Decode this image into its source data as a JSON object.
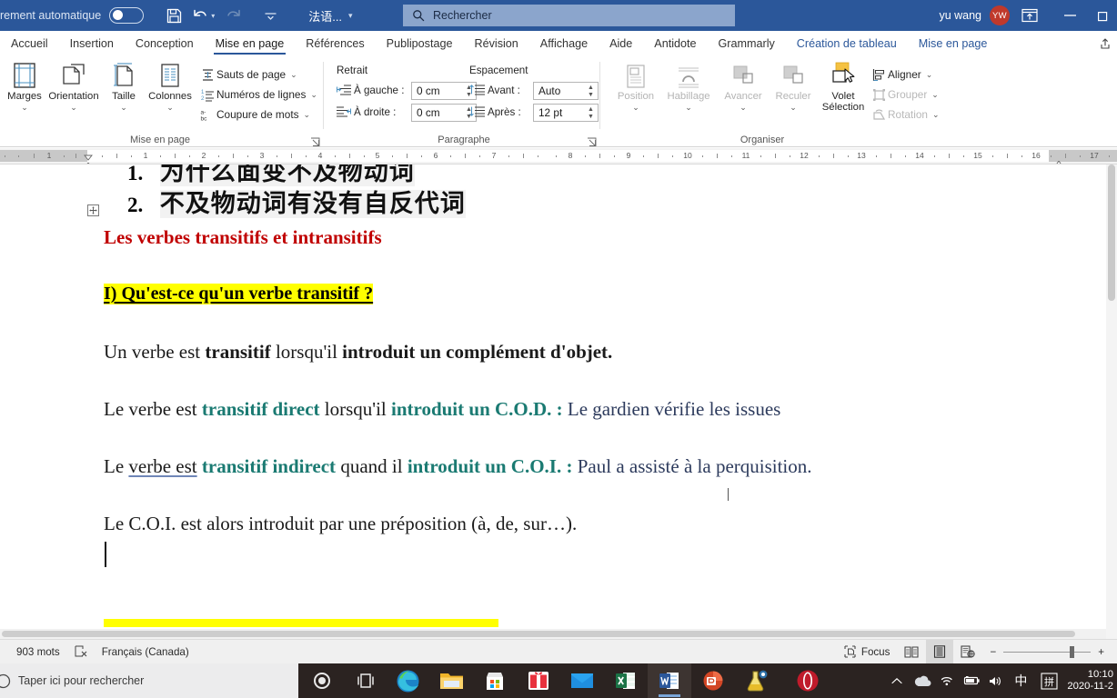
{
  "titlebar": {
    "autosave_label": "rement automatique",
    "autosave_on": false,
    "save_icon": "save-icon",
    "undo_icon": "undo-icon",
    "redo_icon": "redo-icon",
    "customize_icon": "customize-quick-access-icon",
    "language": "法语...",
    "search_placeholder": "Rechercher",
    "search_icon": "search-icon",
    "user_name": "yu wang",
    "user_initials": "YW",
    "ribbon_display_icon": "ribbon-display-options-icon",
    "minimize_icon": "minimize-icon",
    "restore_icon": "restore-icon",
    "accent_color": "#2b579a"
  },
  "tabs": [
    {
      "label": "Accueil",
      "active": false,
      "contextual": false
    },
    {
      "label": "Insertion",
      "active": false,
      "contextual": false
    },
    {
      "label": "Conception",
      "active": false,
      "contextual": false
    },
    {
      "label": "Mise en page",
      "active": true,
      "contextual": false
    },
    {
      "label": "Références",
      "active": false,
      "contextual": false
    },
    {
      "label": "Publipostage",
      "active": false,
      "contextual": false
    },
    {
      "label": "Révision",
      "active": false,
      "contextual": false
    },
    {
      "label": "Affichage",
      "active": false,
      "contextual": false
    },
    {
      "label": "Aide",
      "active": false,
      "contextual": false
    },
    {
      "label": "Antidote",
      "active": false,
      "contextual": false
    },
    {
      "label": "Grammarly",
      "active": false,
      "contextual": false
    },
    {
      "label": "Création de tableau",
      "active": false,
      "contextual": true
    },
    {
      "label": "Mise en page",
      "active": false,
      "contextual": true
    }
  ],
  "ribbon": {
    "groups": [
      {
        "title": "Mise en page"
      },
      {
        "title": "Paragraphe"
      },
      {
        "title": "Organiser"
      }
    ],
    "page_setup": {
      "buttons": [
        {
          "label": "Marges",
          "icon": "margins-icon",
          "has_chevron": true
        },
        {
          "label": "Orientation",
          "icon": "orientation-icon",
          "has_chevron": true
        },
        {
          "label": "Taille",
          "icon": "size-icon",
          "has_chevron": true
        },
        {
          "label": "Colonnes",
          "icon": "columns-icon",
          "has_chevron": true
        }
      ],
      "small_items": [
        {
          "label": "Sauts de page",
          "icon": "page-breaks-icon"
        },
        {
          "label": "Numéros de lignes",
          "icon": "line-numbers-icon"
        },
        {
          "label": "Coupure de mots",
          "icon": "hyphenation-icon"
        }
      ]
    },
    "paragraph": {
      "indent_header": "Retrait",
      "spacing_header": "Espacement",
      "fields": [
        {
          "label": "À gauche :",
          "value": "0 cm",
          "icon": "indent-left-icon"
        },
        {
          "label": "À droite :",
          "value": "0 cm",
          "icon": "indent-right-icon"
        },
        {
          "label": "Avant :",
          "value": "Auto",
          "icon": "spacing-before-icon"
        },
        {
          "label": "Après :",
          "value": "12 pt",
          "icon": "spacing-after-icon"
        }
      ]
    },
    "arrange": {
      "buttons": [
        {
          "label": "Position",
          "icon": "position-icon",
          "disabled": true,
          "has_chevron": true
        },
        {
          "label": "Habillage",
          "icon": "text-wrap-icon",
          "disabled": true,
          "has_chevron": true
        },
        {
          "label": "Avancer",
          "icon": "bring-forward-icon",
          "disabled": true,
          "has_chevron": true
        },
        {
          "label": "Reculer",
          "icon": "send-backward-icon",
          "disabled": true,
          "has_chevron": true
        },
        {
          "label": "Volet",
          "label2": "Sélection",
          "icon": "selection-pane-icon",
          "disabled": false
        }
      ],
      "small_items": [
        {
          "label": "Aligner",
          "icon": "align-icon",
          "disabled": false
        },
        {
          "label": "Grouper",
          "icon": "group-icon",
          "disabled": true
        },
        {
          "label": "Rotation",
          "icon": "rotate-icon",
          "disabled": true
        }
      ]
    }
  },
  "ruler": {
    "left_ticks": [
      "1"
    ],
    "ticks": [
      "1",
      "2",
      "3",
      "4",
      "5",
      "6",
      "7",
      "8",
      "9",
      "10",
      "11",
      "12",
      "13",
      "14",
      "15",
      "16",
      "17"
    ],
    "unit": "cm"
  },
  "document": {
    "lines": [
      {
        "type": "cjk-list",
        "number": "1.",
        "text": "为什么面变不及物动词",
        "clipped": true
      },
      {
        "type": "cjk-list",
        "number": "2.",
        "text": "不及物动词有没有自反代词",
        "clipped": false
      },
      {
        "type": "heading-red",
        "text": "Les verbes transitifs et intransitifs"
      },
      {
        "type": "heading-highlight",
        "text": "I) Qu'est-ce qu'un verbe transitif ?"
      },
      {
        "type": "rich",
        "runs": [
          {
            "t": "Un verbe est ",
            "style": "plain"
          },
          {
            "t": "transitif",
            "style": "bold"
          },
          {
            "t": " lorsqu'il ",
            "style": "plain"
          },
          {
            "t": "introduit un complément d'objet.",
            "style": "bold"
          }
        ]
      },
      {
        "type": "rich",
        "runs": [
          {
            "t": "Le verbe est ",
            "style": "plain"
          },
          {
            "t": "transitif direct",
            "style": "teal-bold"
          },
          {
            "t": " lorsqu'il ",
            "style": "plain"
          },
          {
            "t": "introduit un C.O.D. :",
            "style": "teal-bold"
          },
          {
            "t": "  Le gardien vérifie les issues",
            "style": "navy"
          }
        ]
      },
      {
        "type": "rich",
        "runs": [
          {
            "t": "Le ",
            "style": "plain"
          },
          {
            "t": "verbe  est",
            "style": "underline"
          },
          {
            "t": " ",
            "style": "plain"
          },
          {
            "t": "transitif indirect",
            "style": "teal-bold"
          },
          {
            "t": " quand il ",
            "style": "plain"
          },
          {
            "t": "introduit un C.O.I. :",
            "style": "teal-bold"
          },
          {
            "t": " Paul a assisté à la perquisition.",
            "style": "navy"
          }
        ]
      },
      {
        "type": "rich",
        "runs": [
          {
            "t": "Le C.O.I. est alors introduit par une préposition (à, de, sur…).",
            "style": "plain"
          }
        ]
      }
    ],
    "highlight_color": "#ffff00",
    "heading_color": "#c00000",
    "teal_color": "#1a7a72",
    "navy_color": "#2c3a5c",
    "move_handle_icon": "table-move-handle-icon"
  },
  "statusbar": {
    "word_count": "903 mots",
    "proofing_icon": "proofing-errors-icon",
    "language": "Français (Canada)",
    "focus_label": "Focus",
    "focus_icon": "focus-mode-icon",
    "view_read_icon": "read-mode-icon",
    "view_print_icon": "print-layout-icon",
    "view_web_icon": "web-layout-icon",
    "zoom_out": "−",
    "zoom_in": "+"
  },
  "taskbar": {
    "search_placeholder": "Taper ici pour rechercher",
    "search_icon": "cortana-circle-icon",
    "taskview_icon": "task-view-icon",
    "apps": [
      {
        "name": "edge-icon",
        "running": true,
        "active": false
      },
      {
        "name": "file-explorer-icon",
        "running": true,
        "active": false
      },
      {
        "name": "microsoft-store-icon",
        "running": false,
        "active": false
      },
      {
        "name": "gift-app-icon",
        "running": false,
        "active": false
      },
      {
        "name": "mail-icon",
        "running": false,
        "active": false
      },
      {
        "name": "excel-icon",
        "running": true,
        "active": false
      },
      {
        "name": "word-icon",
        "running": true,
        "active": true
      },
      {
        "name": "powerpoint-icon",
        "running": true,
        "active": false
      },
      {
        "name": "antidote-icon",
        "running": true,
        "active": false
      },
      {
        "name": "opera-icon",
        "running": true,
        "active": false
      }
    ],
    "tray": [
      {
        "name": "show-hidden-icons-icon"
      },
      {
        "name": "onedrive-icon"
      },
      {
        "name": "wifi-icon"
      },
      {
        "name": "battery-icon"
      },
      {
        "name": "volume-icon"
      },
      {
        "name": "ime-chinese-icon",
        "glyph": "中"
      },
      {
        "name": "ime-pinyin-icon",
        "glyph": "拼"
      }
    ],
    "clock_time": "10:10",
    "clock_date": "2020-11-2"
  }
}
